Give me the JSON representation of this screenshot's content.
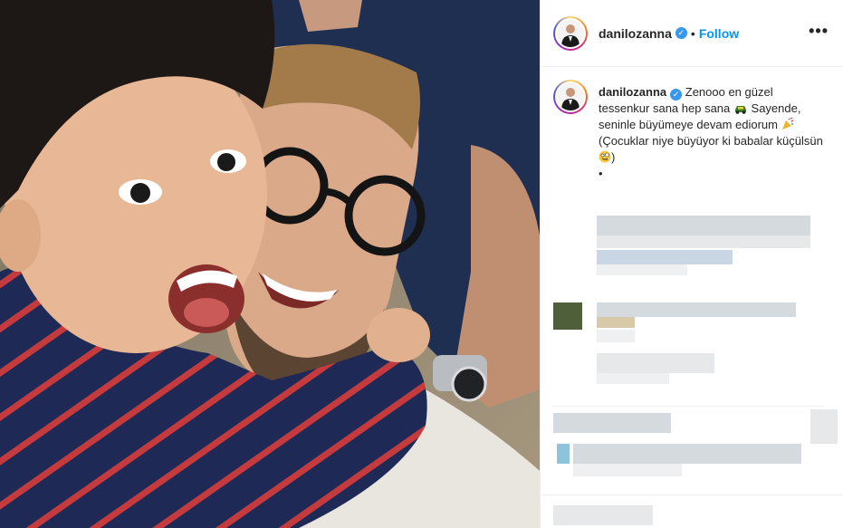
{
  "post": {
    "username": "danilozanna",
    "follow_label": "Follow",
    "separator": "•",
    "more_label": "•••"
  },
  "caption": {
    "username": "danilozanna",
    "line1": "Zenooo en güzel tessenkur sana hep sana",
    "line2": "Sayende, seninle büyümeye devam ediorum",
    "line3": "(Çocuklar niye büyüyor ki babalar küçülsün",
    "line3_end": ")",
    "line4": "•"
  },
  "colors": {
    "follow": "#0095f6",
    "verified": "#3897f0",
    "text": "#262626",
    "divider": "#efefef"
  },
  "icons": {
    "verified": "verified-badge-icon",
    "more": "more-options-icon"
  }
}
